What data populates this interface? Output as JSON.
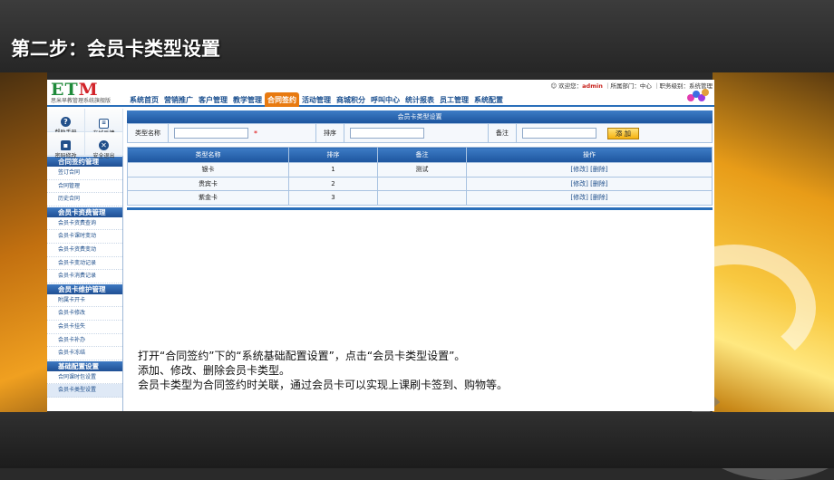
{
  "slide": {
    "title": "第二步：会员卡类型设置",
    "description": [
      "打开“合同签约”下的“系统基础配置设置”，点击“会员卡类型设置”。",
      "添加、修改、删除会员卡类型。",
      "会员卡类型为合同签约时关联，通过会员卡可以实现上课刷卡签到、购物等。"
    ]
  },
  "header": {
    "logo_letters": [
      "E",
      "T",
      "M"
    ],
    "logo_sub": "思米早教管理系统旗舰版",
    "welcome_prefix": "欢迎您：",
    "user": "admin",
    "dept_text": "｜所属部门：中心 ｜职务级别：系统管理"
  },
  "nav": {
    "items": [
      "系统首页",
      "营销推广",
      "客户管理",
      "教学管理",
      "合同签约",
      "活动管理",
      "商城积分",
      "呼叫中心",
      "统计报表",
      "员工管理",
      "系统配置"
    ],
    "active": "合同签约"
  },
  "sidebar": {
    "tools": [
      {
        "icon": "help-icon",
        "glyph": "?",
        "label": "帮助手册"
      },
      {
        "icon": "feedback-icon",
        "glyph": "≡",
        "label": "在线反馈"
      },
      {
        "icon": "lock-icon",
        "glyph": "▪",
        "label": "密码修改"
      },
      {
        "icon": "exit-icon",
        "glyph": "✕",
        "label": "安全退出"
      }
    ],
    "sections": [
      {
        "title": "合同签约管理",
        "links": [
          "签订合同",
          "合同管理",
          "历史合同"
        ]
      },
      {
        "title": "会员卡资费管理",
        "links": [
          "会员卡资费查询",
          "会员卡课时变动",
          "会员卡资费变动",
          "会员卡变动记录",
          "会员卡消费记录"
        ]
      },
      {
        "title": "会员卡维护管理",
        "links": [
          "附属卡开卡",
          "会员卡修改",
          "会员卡挂失",
          "会员卡补办",
          "会员卡冻结"
        ]
      },
      {
        "title": "基础配置设置",
        "links": [
          "合同课时包设置",
          "会员卡类型设置"
        ]
      }
    ],
    "active_link": "会员卡类型设置"
  },
  "panel": {
    "title": "会员卡类型设置",
    "form": {
      "name_label": "类型名称",
      "required_mark": "*",
      "sort_label": "排序",
      "remark_label": "备注",
      "add_button": "添 加"
    },
    "table": {
      "columns": [
        "类型名称",
        "排序",
        "备注",
        "操作"
      ],
      "rows": [
        {
          "name": "银卡",
          "sort": "1",
          "remark": "测试",
          "ops": "[修改] [删除]"
        },
        {
          "name": "贵宾卡",
          "sort": "2",
          "remark": "",
          "ops": "[修改] [删除]"
        },
        {
          "name": "紫金卡",
          "sort": "3",
          "remark": "",
          "ops": "[修改] [删除]"
        }
      ]
    }
  },
  "colors": {
    "accent_blue": "#2a6fba",
    "nav_active": "#e87a10",
    "logo_green": "#1f8a3a",
    "logo_red": "#d2242a"
  }
}
